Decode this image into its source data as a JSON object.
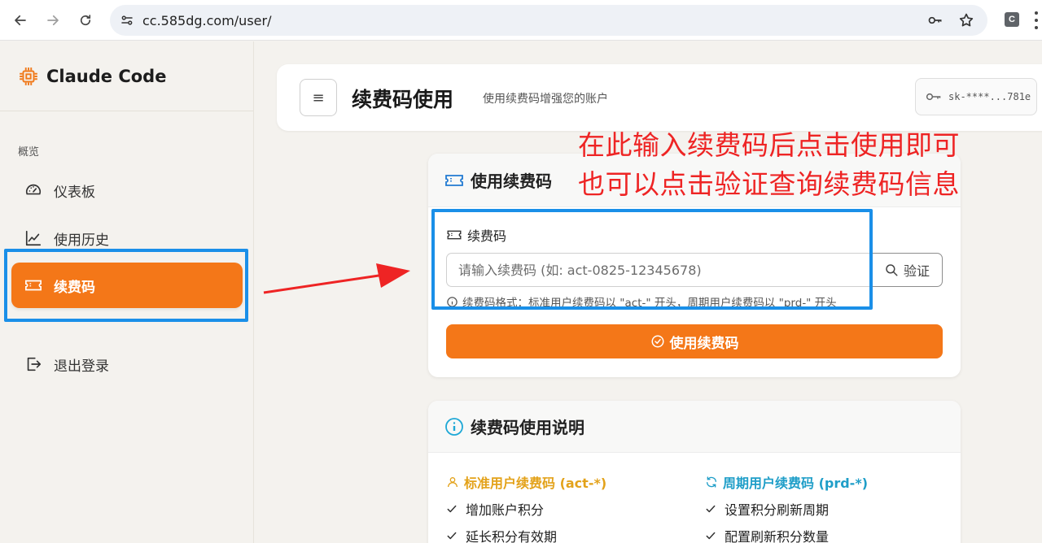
{
  "browser": {
    "url": "cc.585dg.com/user/",
    "extension_letter": "C"
  },
  "sidebar": {
    "brand": "Claude Code",
    "section_label": "概览",
    "items": [
      {
        "label": "仪表板",
        "icon": "dashboard-gauge-icon",
        "active": false
      },
      {
        "label": "使用历史",
        "icon": "line-chart-icon",
        "active": false
      },
      {
        "label": "续费码",
        "icon": "ticket-icon",
        "active": true
      },
      {
        "label": "退出登录",
        "icon": "logout-icon",
        "active": false
      }
    ]
  },
  "header": {
    "menu_glyph": "≡",
    "title": "续费码使用",
    "subtitle": "使用续费码增强您的账户",
    "api_key": "sk-****...781e"
  },
  "use_card": {
    "title": "使用续费码",
    "field_label": "续费码",
    "input_placeholder": "请输入续费码 (如: act-0825-12345678)",
    "verify_label": "验证",
    "hint": "续费码格式：标准用户续费码以 \"act-\" 开头，周期用户续费码以 \"prd-\" 开头",
    "submit_label": "使用续费码"
  },
  "info_card": {
    "title": "续费码使用说明",
    "columns": [
      {
        "title": "标准用户续费码 (act-*)",
        "items": [
          "增加账户积分",
          "延长积分有效期"
        ]
      },
      {
        "title": "周期用户续费码 (prd-*)",
        "items": [
          "设置积分刷新周期",
          "配置刷新积分数量"
        ]
      }
    ]
  },
  "annotation": {
    "line1": "在此输入续费码后点击使用即可",
    "line2": "也可以点击验证查询续费码信息"
  },
  "colors": {
    "accent": "#f47718",
    "highlight_box": "#1a8fe8",
    "annotation": "#ee2424"
  }
}
